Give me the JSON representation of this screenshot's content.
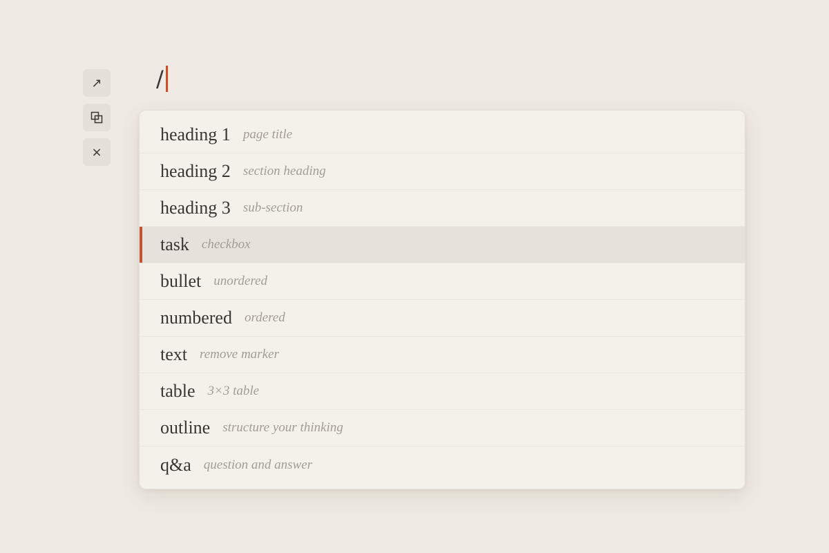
{
  "toolbar": {
    "buttons": [
      {
        "icon": "arrow-up-right-icon",
        "glyph": "↗"
      },
      {
        "icon": "copy-icon"
      },
      {
        "icon": "close-icon",
        "glyph": "×"
      }
    ]
  },
  "editor": {
    "text": "/"
  },
  "menu": {
    "active_index": 3,
    "items": [
      {
        "label": "heading 1",
        "desc": "page title"
      },
      {
        "label": "heading 2",
        "desc": "section heading"
      },
      {
        "label": "heading 3",
        "desc": "sub-section"
      },
      {
        "label": "task",
        "desc": "checkbox"
      },
      {
        "label": "bullet",
        "desc": "unordered"
      },
      {
        "label": "numbered",
        "desc": "ordered"
      },
      {
        "label": "text",
        "desc": "remove marker"
      },
      {
        "label": "table",
        "desc": "3×3 table"
      },
      {
        "label": "outline",
        "desc": "structure your thinking"
      },
      {
        "label": "q&a",
        "desc": "question and answer"
      }
    ]
  },
  "colors": {
    "accent": "#c0532f",
    "background": "#efeae3",
    "menu_background": "#f4f0ea",
    "active_row": "#e6e1db"
  }
}
